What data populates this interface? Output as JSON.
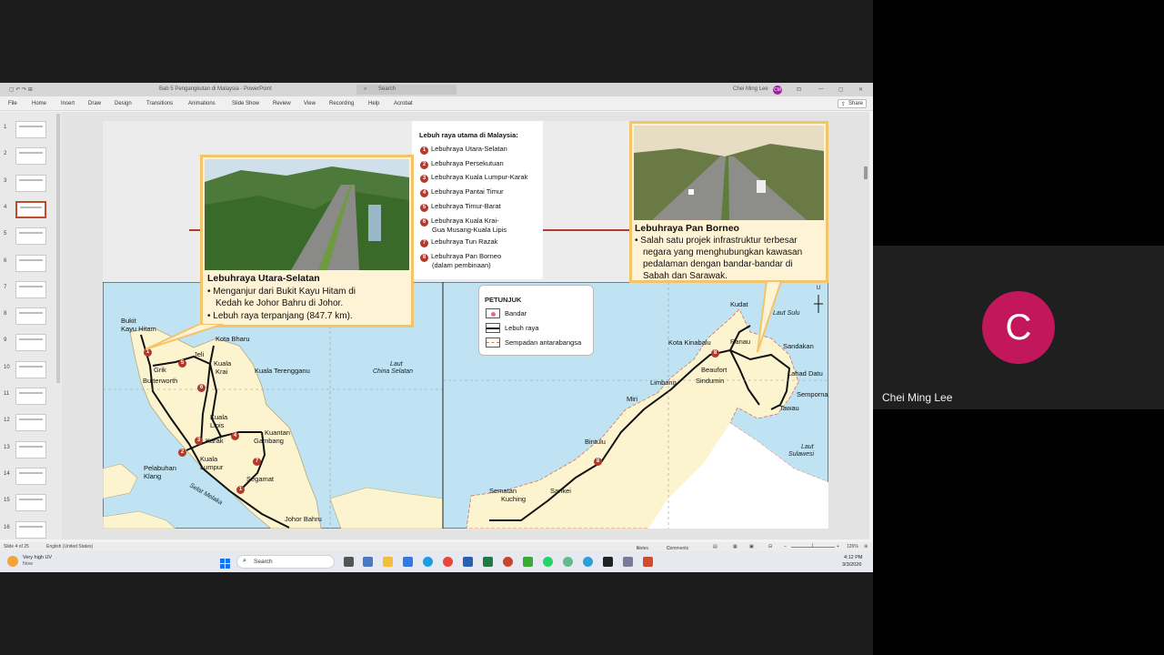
{
  "window": {
    "title": "Bab 5 Pengangkutan di Malaysia - PowerPoint",
    "search_placeholder": "Search",
    "user": "Chei Ming Lee",
    "user_initials": "CM"
  },
  "ribbon": {
    "tabs": [
      "File",
      "Home",
      "Insert",
      "Draw",
      "Design",
      "Transitions",
      "Animations",
      "Slide Show",
      "Review",
      "View",
      "Recording",
      "Help",
      "Acrobat"
    ],
    "share_label": "Share"
  },
  "thumbnails": {
    "numbers": [
      "1",
      "2",
      "3",
      "4",
      "5",
      "6",
      "7",
      "8",
      "9",
      "10",
      "11",
      "12",
      "13",
      "14",
      "15",
      "16"
    ],
    "selected": "4"
  },
  "slide": {
    "legend_title": "Lebuh raya utama di Malaysia:",
    "highways": [
      {
        "n": "1",
        "name": "Lebuhraya Utara-Selatan"
      },
      {
        "n": "2",
        "name": "Lebuhraya Persekutuan"
      },
      {
        "n": "3",
        "name": "Lebuhraya Kuala Lumpur-Karak"
      },
      {
        "n": "4",
        "name": "Lebuhraya Pantai Timur"
      },
      {
        "n": "5",
        "name": "Lebuhraya Timur-Barat"
      },
      {
        "n": "6",
        "name": "Lebuhraya Kuala Krai-",
        "name2": "Gua Musang-Kuala Lipis"
      },
      {
        "n": "7",
        "name": "Lebuhraya Tun Razak"
      },
      {
        "n": "8",
        "name": "Lebuhraya Pan Borneo",
        "name2": "(dalam pembinaan)"
      }
    ],
    "left_card": {
      "title": "Lebuhraya Utara-Selatan",
      "bullet1": "Menganjur dari Bukit Kayu Hitam di",
      "bullet1b": "Kedah ke Johor Bahru di Johor.",
      "bullet2": "Lebuh raya terpanjang (847.7 km)."
    },
    "right_card": {
      "title": "Lebuhraya Pan Borneo",
      "line1": "Salah satu projek infrastruktur terbesar",
      "line2": "negara yang menghubungkan kawasan",
      "line3": "pedalaman dengan bandar-bandar di",
      "line4": "Sabah dan Sarawak."
    },
    "key": {
      "title": "PETUNJUK",
      "items": [
        "Bandar",
        "Lebuh raya",
        "Sempadan antarabangsa"
      ]
    },
    "compass": "U",
    "peninsula_labels": {
      "bukit": "Bukit",
      "kayu_hitam": "Kayu Hitam",
      "kota_bharu": "Kota Bharu",
      "jeli": "Jeli",
      "kuala_krai_1": "Kuala",
      "kuala_krai_2": "Krai",
      "gerik": "Grik",
      "kuala_terengganu": "Kuala Terengganu",
      "butterworth": "Butterworth",
      "kuala_lipis_1": "Kuala",
      "kuala_lipis_2": "Lipis",
      "kuantan": "Kuantan",
      "gambang": "Gambang",
      "karak": "Karak",
      "kl_1": "Kuala",
      "kl_2": "Lumpur",
      "pelabuhan_1": "Pelabuhan",
      "pelabuhan_2": "Klang",
      "segamat": "Segamat",
      "johor_bahru": "Johor Bahru",
      "selat_melaka": "Selat Melaka",
      "laut_china_1": "Laut",
      "laut_china_2": "China Selatan"
    },
    "borneo_labels": {
      "kudat": "Kudat",
      "laut_sulu": "Laut Sulu",
      "kota_kinabalu": "Kota Kinabalu",
      "ranau": "Ranau",
      "sandakan": "Sandakan",
      "beaufort": "Beaufort",
      "lahad_datu": "Lahad Datu",
      "limbang": "Limbang",
      "sindumin": "Sindumin",
      "semporna": "Semporna",
      "miri": "Miri",
      "tawau": "Tawau",
      "bintulu": "Bintulu",
      "laut_sulawesi_1": "Laut",
      "laut_sulawesi_2": "Sulawesi",
      "sematan": "Sematan",
      "kuching": "Kuching",
      "sarikei": "Sarikei"
    }
  },
  "statusbar": {
    "slide_info": "Slide 4 of 25",
    "language": "English (United States)",
    "notes": "Notes",
    "comments": "Comments",
    "zoom": "126%"
  },
  "taskbar": {
    "weather": "Very high UV",
    "weather_sub": "Now",
    "search": "Search",
    "time": "4:12 PM",
    "date": "3/3/2026"
  },
  "participant": {
    "initial": "C",
    "name": "Chei Ming Lee"
  },
  "colors": {
    "panel_fill": "#fff3d6",
    "panel_border": "#f3c46a",
    "sea": "#bfe3f2",
    "land": "#fbf4cf",
    "highway_marker": "#b23a2a",
    "avatar": "#c2185b"
  }
}
